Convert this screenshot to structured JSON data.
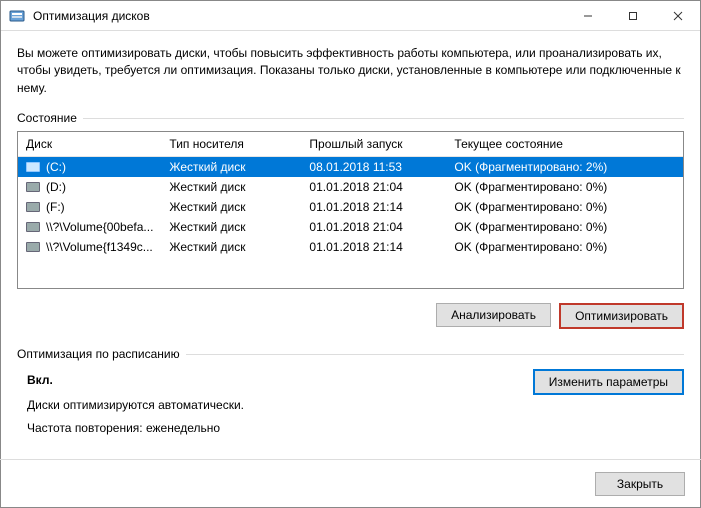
{
  "window": {
    "title": "Оптимизация дисков"
  },
  "description": "Вы можете оптимизировать диски, чтобы повысить эффективность работы  компьютера, или проанализировать их, чтобы увидеть, требуется ли оптимизация. Показаны только диски, установленные в компьютере или подключенные к нему.",
  "state_label": "Состояние",
  "columns": {
    "disk": "Диск",
    "media": "Тип носителя",
    "last_run": "Прошлый запуск",
    "status": "Текущее состояние"
  },
  "rows": [
    {
      "name": "(C:)",
      "media": "Жесткий диск",
      "last_run": "08.01.2018 11:53",
      "status": "OK (Фрагментировано: 2%)",
      "selected": true
    },
    {
      "name": "(D:)",
      "media": "Жесткий диск",
      "last_run": "01.01.2018 21:04",
      "status": "OK (Фрагментировано: 0%)",
      "selected": false
    },
    {
      "name": "(F:)",
      "media": "Жесткий диск",
      "last_run": "01.01.2018 21:14",
      "status": "OK (Фрагментировано: 0%)",
      "selected": false
    },
    {
      "name": "\\\\?\\Volume{00befa...",
      "media": "Жесткий диск",
      "last_run": "01.01.2018 21:04",
      "status": "OK (Фрагментировано: 0%)",
      "selected": false
    },
    {
      "name": "\\\\?\\Volume{f1349c...",
      "media": "Жесткий диск",
      "last_run": "01.01.2018 21:14",
      "status": "OK (Фрагментировано: 0%)",
      "selected": false
    }
  ],
  "buttons": {
    "analyze": "Анализировать",
    "optimize": "Оптимизировать",
    "change_settings": "Изменить параметры",
    "close": "Закрыть"
  },
  "schedule": {
    "label": "Оптимизация по расписанию",
    "on": "Вкл.",
    "line1": "Диски оптимизируются автоматически.",
    "line2": "Частота повторения: еженедельно"
  }
}
